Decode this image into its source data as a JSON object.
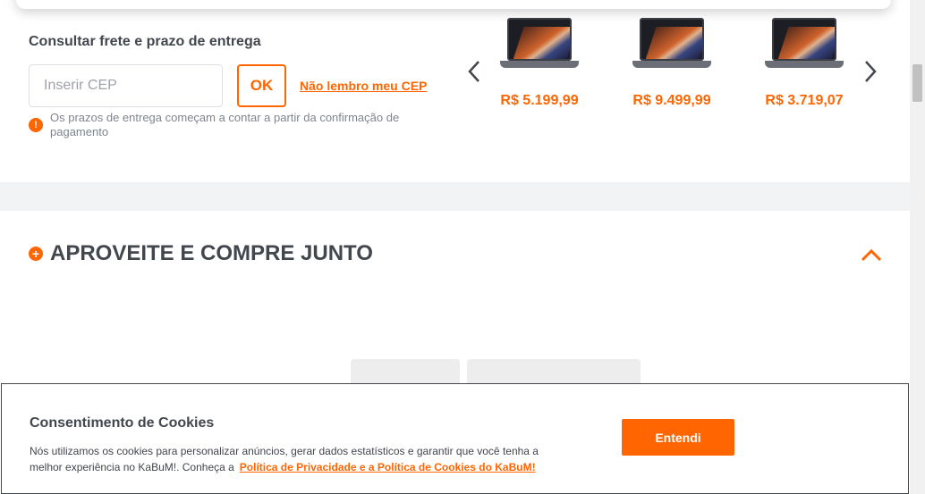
{
  "shipping": {
    "title": "Consultar frete e prazo de entrega",
    "cep_placeholder": "Inserir CEP",
    "cep_value": "",
    "ok_label": "OK",
    "forgot_cep_label": "Não lembro meu CEP",
    "notice": "Os prazos de entrega começam a contar a partir da confirmação de pagamento",
    "notice_icon": "alert-icon"
  },
  "carousel": {
    "prev_icon": "chevron-left-icon",
    "next_icon": "chevron-right-icon",
    "products": [
      {
        "price": "R$ 5.199,99"
      },
      {
        "price": "R$ 9.499,99"
      },
      {
        "price": "R$ 3.719,07"
      }
    ]
  },
  "section": {
    "title": "APROVEITE E COMPRE JUNTO",
    "icon": "plus-circle-icon",
    "toggle_icon": "chevron-up-icon"
  },
  "cookie": {
    "title": "Consentimento de Cookies",
    "text": "Nós utilizamos os cookies para personalizar anúncios, gerar dados estatísticos e garantir que você tenha a melhor experiência no KaBuM!. Conheça a",
    "link_label": "Política de Privacidade e a Política de Cookies do KaBuM!",
    "accept_label": "Entendi"
  },
  "colors": {
    "accent": "#ff6500",
    "text": "#42464d",
    "muted": "#7f858d"
  }
}
